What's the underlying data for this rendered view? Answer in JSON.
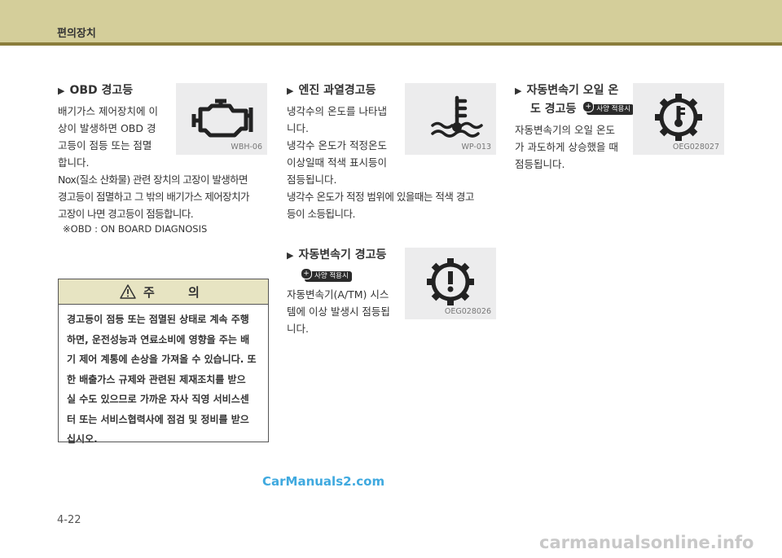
{
  "header": {
    "title": "편의장치"
  },
  "obd": {
    "title_bold": "OBD",
    "title_rest": " 경고등",
    "lines": [
      "배기가스 제어장치에 이",
      "상이 발생하면 OBD 경",
      "고등이 점등 또는 점멸",
      "합니다."
    ],
    "lines_wide": [
      "Nox(질소 산화물) 관련 장치의 고장이 발생하면",
      "경고등이 점멸하고 그 밖의 배기가스 제어장치가",
      "고장이 나면 경고등이 점등합니다."
    ],
    "note": "※OBD : ON BOARD DIAGNOSIS",
    "icon_code": "WBH-06"
  },
  "caution": {
    "label": "주 의",
    "lines": [
      "경고등이 점등 또는 점멸된 상태로 계속 주행",
      "하면, 운전성능과 연료소비에 영향을 주는 배",
      "기 제어 계통에 손상을 가져올 수 있습니다. 또",
      "한 배출가스 규제와 관련된 제재조치를 받으",
      "실 수도 있으므로 가까운 자사 직영 서비스센",
      "터 또는 서비스협력사에 점검 및 정비를 받으",
      "십시오."
    ]
  },
  "engine_temp": {
    "title": "엔진 과열경고등",
    "lines": [
      "냉각수의 온도를 나타냅",
      "니다.",
      "냉각수 온도가 적정온도",
      "이상일때 적색 표시등이",
      "점등됩니다."
    ],
    "lines_wide": [
      "냉각수 온도가 적정 범위에 있을때는 적색 경고",
      "등이 소등됩니다."
    ],
    "icon_code": "WP-013"
  },
  "trans_warning": {
    "title": "자동변속기 경고등",
    "badge": "사양 적용시",
    "lines": [
      "자동변속기(A/TM) 시스",
      "템에 이상 발생시 점등됩",
      "니다."
    ],
    "icon_code": "OEG028026"
  },
  "trans_oil": {
    "title_line1": "자동변속기 오일 온",
    "title_line2": "도 경고등",
    "badge": "사양 적용시",
    "lines": [
      "자동변속기의 오일 온도",
      "가 과도하게 상승했을 때",
      "점등됩니다."
    ],
    "icon_code": "OEG028027"
  },
  "footer": {
    "watermark": "CarManuals2.com",
    "page_number": "4-22",
    "site": "carmanualsonline.info"
  },
  "colors": {
    "header_bg": "#d4ce9a",
    "header_line": "#8a7d3c",
    "caution_head_bg": "#e7e4c2",
    "icon_bg": "#ececed",
    "watermark": "#3fa9df"
  }
}
